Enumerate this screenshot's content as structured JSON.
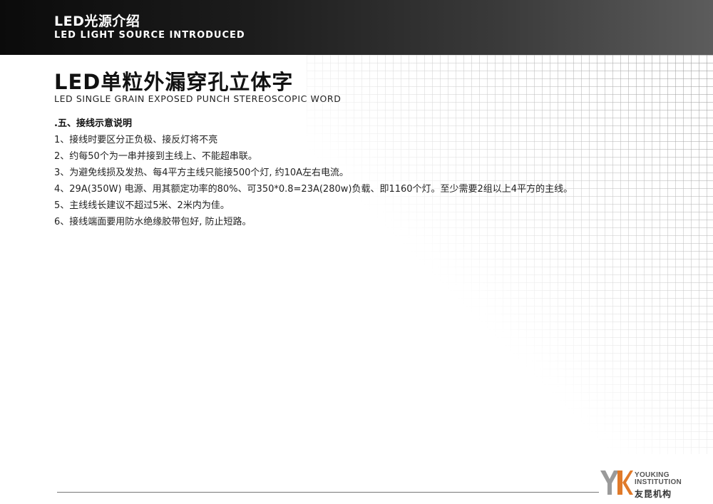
{
  "header": {
    "title": "LED光源介绍",
    "subtitle": "LED LIGHT SOURCE INTRODUCED"
  },
  "page": {
    "title": "LED单粒外漏穿孔立体字",
    "subtitle": "LED SINGLE GRAIN EXPOSED PUNCH STEREOSCOPIC WORD"
  },
  "content": {
    "heading": ".五、接线示意说明",
    "lines": [
      "1、接线时要区分正负极、接反灯将不亮",
      "2、约每50个为一串并接到主线上、不能超串联。",
      "3、为避免线损及发热、每4平方主线只能接500个灯, 约10A左右电流。",
      "4、29A(350W)  电源、用其额定功率的80%、可350*0.8=23A(280w)负载、即1160个灯。至少需要2组以上4平方的主线。",
      "5、主线线长建议不超过5米、2米内为佳。",
      "6、接线端面要用防水绝缘胶带包好, 防止短路。"
    ]
  },
  "logo": {
    "mark": "YK",
    "en_line1": "YOUKING",
    "en_line2": "INSTITUTION",
    "cn": "友昆机构",
    "colors": {
      "y": "#9a9a9a",
      "k": "#e07a2a"
    }
  }
}
